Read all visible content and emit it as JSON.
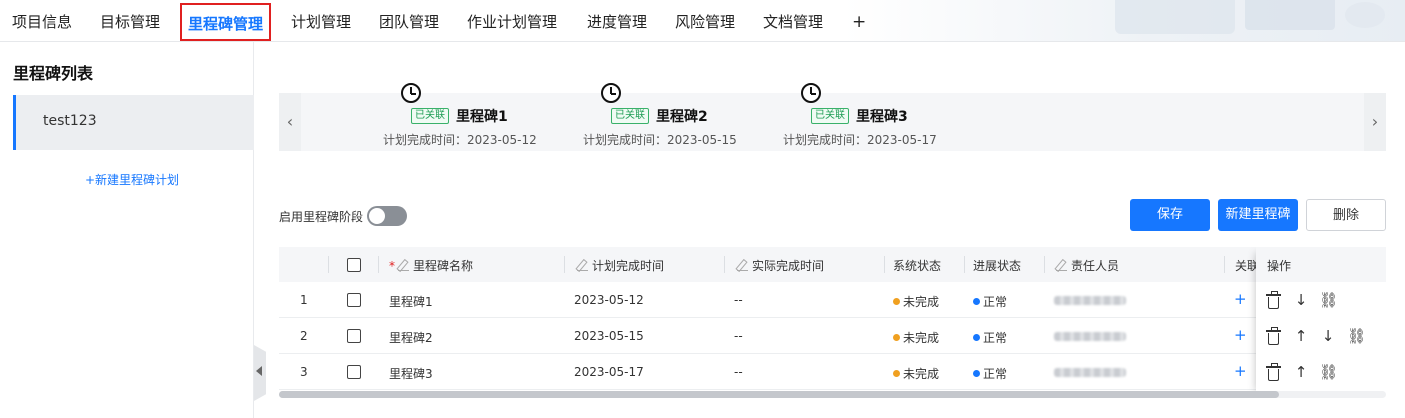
{
  "nav": {
    "tabs": [
      {
        "label": "项目信息"
      },
      {
        "label": "目标管理"
      },
      {
        "label": "里程碑管理",
        "active": true
      },
      {
        "label": "计划管理"
      },
      {
        "label": "团队管理"
      },
      {
        "label": "作业计划管理"
      },
      {
        "label": "进度管理"
      },
      {
        "label": "风险管理"
      },
      {
        "label": "文档管理"
      }
    ],
    "add_label": "+"
  },
  "sidebar": {
    "title": "里程碑列表",
    "items": [
      {
        "label": "test123",
        "selected": true
      }
    ],
    "new_plan_label": "+新建里程碑计划"
  },
  "timeline": {
    "prev_label": "‹",
    "next_label": "›",
    "milestones": [
      {
        "badge": "已关联",
        "name": "里程碑1",
        "date_label": "计划完成时间：",
        "date": "2023-05-12"
      },
      {
        "badge": "已关联",
        "name": "里程碑2",
        "date_label": "计划完成时间：",
        "date": "2023-05-15"
      },
      {
        "badge": "已关联",
        "name": "里程碑3",
        "date_label": "计划完成时间：",
        "date": "2023-05-17"
      }
    ]
  },
  "toolbar": {
    "stage_switch_label": "启用里程碑阶段",
    "stage_switch_on": false,
    "save_label": "保存",
    "new_label": "新建里程碑",
    "delete_label": "删除"
  },
  "table": {
    "columns": {
      "name": "里程碑名称",
      "planned": "计划完成时间",
      "actual": "实际完成时间",
      "system_status": "系统状态",
      "progress_status": "进展状态",
      "owner": "责任人员",
      "linked": "关联",
      "ops": "操作"
    },
    "rows": [
      {
        "index": "1",
        "name": "里程碑1",
        "planned": "2023-05-12",
        "actual": "--",
        "system_status": "未完成",
        "progress_status": "正常",
        "linked": "+"
      },
      {
        "index": "2",
        "name": "里程碑2",
        "planned": "2023-05-15",
        "actual": "--",
        "system_status": "未完成",
        "progress_status": "正常",
        "linked": "+"
      },
      {
        "index": "3",
        "name": "里程碑3",
        "planned": "2023-05-17",
        "actual": "--",
        "system_status": "未完成",
        "progress_status": "正常",
        "linked": "+"
      }
    ],
    "required_mark": "*"
  },
  "icons": {
    "clock": "clock-icon",
    "edit": "pencil-icon",
    "delete": "trash-icon",
    "up": "arrow-up-icon",
    "down": "arrow-down-icon",
    "unlink": "unlink-icon"
  },
  "colors": {
    "accent": "#1677ff",
    "highlight_border": "#e02020",
    "status_incomplete": "#f0a020",
    "status_normal": "#1677ff",
    "linked_badge": "#1f9d55"
  }
}
